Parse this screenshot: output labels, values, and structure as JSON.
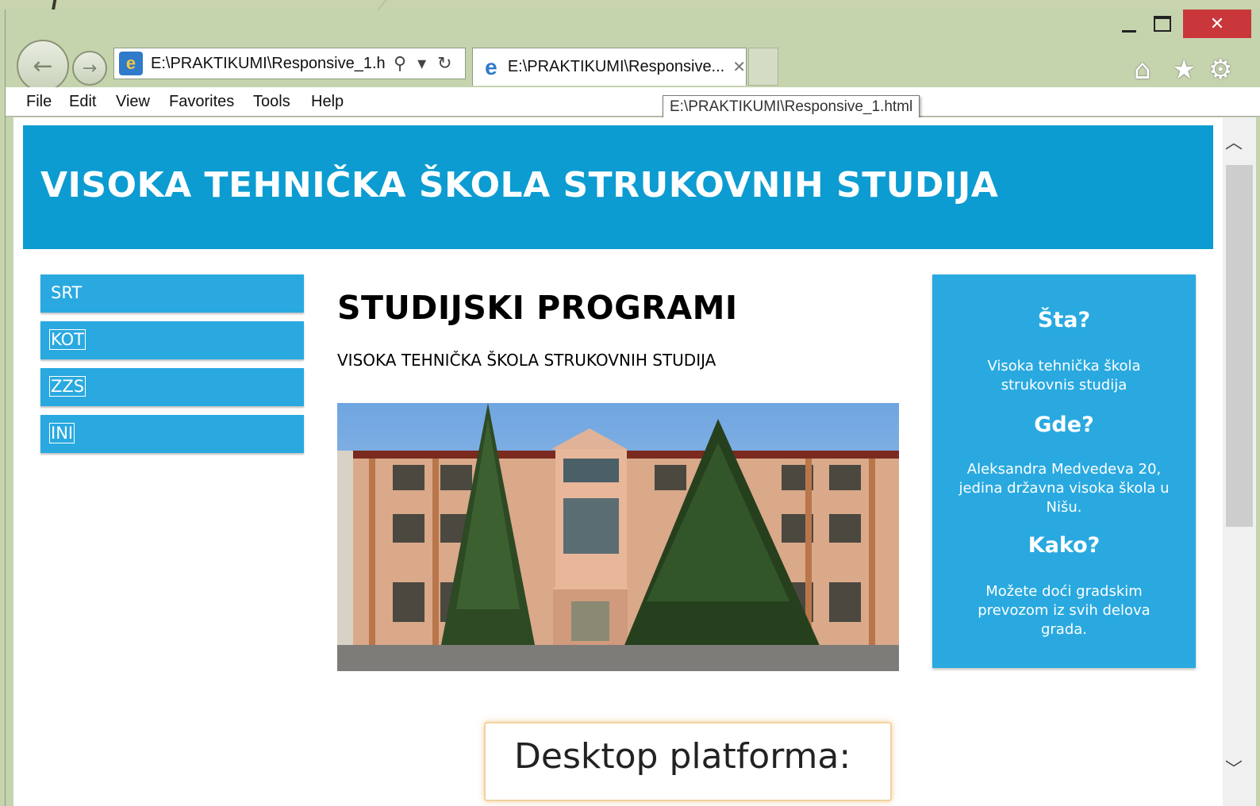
{
  "browser": {
    "address": "E:\\PRAKTIKUMI\\Responsive_1.h",
    "tab_title": "E:\\PRAKTIKUMI\\Responsive...",
    "tooltip": "E:\\PRAKTIKUMI\\Responsive_1.html",
    "menu": [
      "File",
      "Edit",
      "View",
      "Favorites",
      "Tools",
      "Help"
    ]
  },
  "site": {
    "header_title": "VISOKA TEHNIČKA ŠKOLA STRUKOVNIH STUDIJA",
    "nav": [
      "SRT",
      "KOT",
      "ZZS",
      "INI"
    ],
    "main_heading": "STUDIJSKI PROGRAMI",
    "main_subtitle": "VISOKA TEHNIČKA ŠKOLA STRUKOVNIH STUDIJA",
    "aside": {
      "q1": "Šta?",
      "a1": "Visoka tehnička škola strukovnis studija",
      "q2": "Gde?",
      "a2": "Aleksandra Medvedeva 20, jedina državna visoka škola u Nišu.",
      "q3": "Kako?",
      "a3": "Možete doći gradskim prevozom iz svih delova grada."
    }
  },
  "slide_caption": "Desktop platforma:",
  "colors": {
    "header": "#0c9cd1",
    "nav": "#29a9e0",
    "slide_bg": "#c7d4ad",
    "close_button": "#c9373b"
  },
  "icons": [
    "back-icon",
    "forward-icon",
    "ie-icon",
    "search-icon",
    "dropdown-icon",
    "refresh-icon",
    "tab-close-icon",
    "home-icon",
    "star-icon",
    "gear-icon",
    "minimize-icon",
    "maximize-icon",
    "close-icon",
    "scroll-up-icon",
    "scroll-down-icon"
  ]
}
